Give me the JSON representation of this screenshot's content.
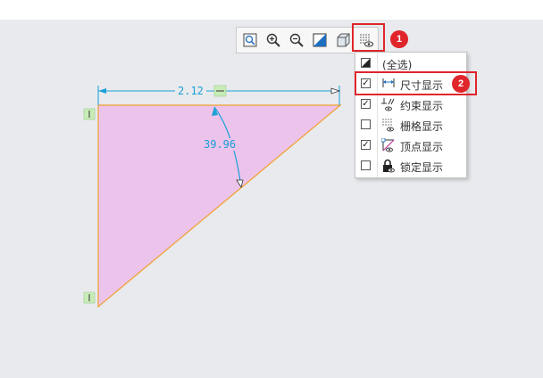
{
  "toolbar": {
    "buttons": [
      {
        "icon": "zoom-fit-icon"
      },
      {
        "icon": "zoom-in-icon"
      },
      {
        "icon": "zoom-out-icon"
      },
      {
        "icon": "shaded-view-icon"
      },
      {
        "icon": "box-view-icon"
      },
      {
        "icon": "display-filter-icon"
      }
    ]
  },
  "callouts": {
    "one": "1",
    "two": "2"
  },
  "menu": {
    "items": [
      {
        "label": "(全选)",
        "checked": "partial",
        "icon": "select-all-icon"
      },
      {
        "label": "尺寸显示",
        "checked": "true",
        "icon": "dimension-display-icon"
      },
      {
        "label": "约束显示",
        "checked": "true",
        "icon": "constraint-display-icon"
      },
      {
        "label": "栅格显示",
        "checked": "false",
        "icon": "grid-display-icon"
      },
      {
        "label": "顶点显示",
        "checked": "true",
        "icon": "vertex-display-icon"
      },
      {
        "label": "锁定显示",
        "checked": "false",
        "icon": "lock-display-icon"
      }
    ]
  },
  "sketch": {
    "dimension_length": "2.12",
    "dimension_angle": "39.96",
    "fill_color": "#ecc3ea",
    "edge_color": "#f0a030",
    "dimension_color": "#1aa0d8"
  }
}
